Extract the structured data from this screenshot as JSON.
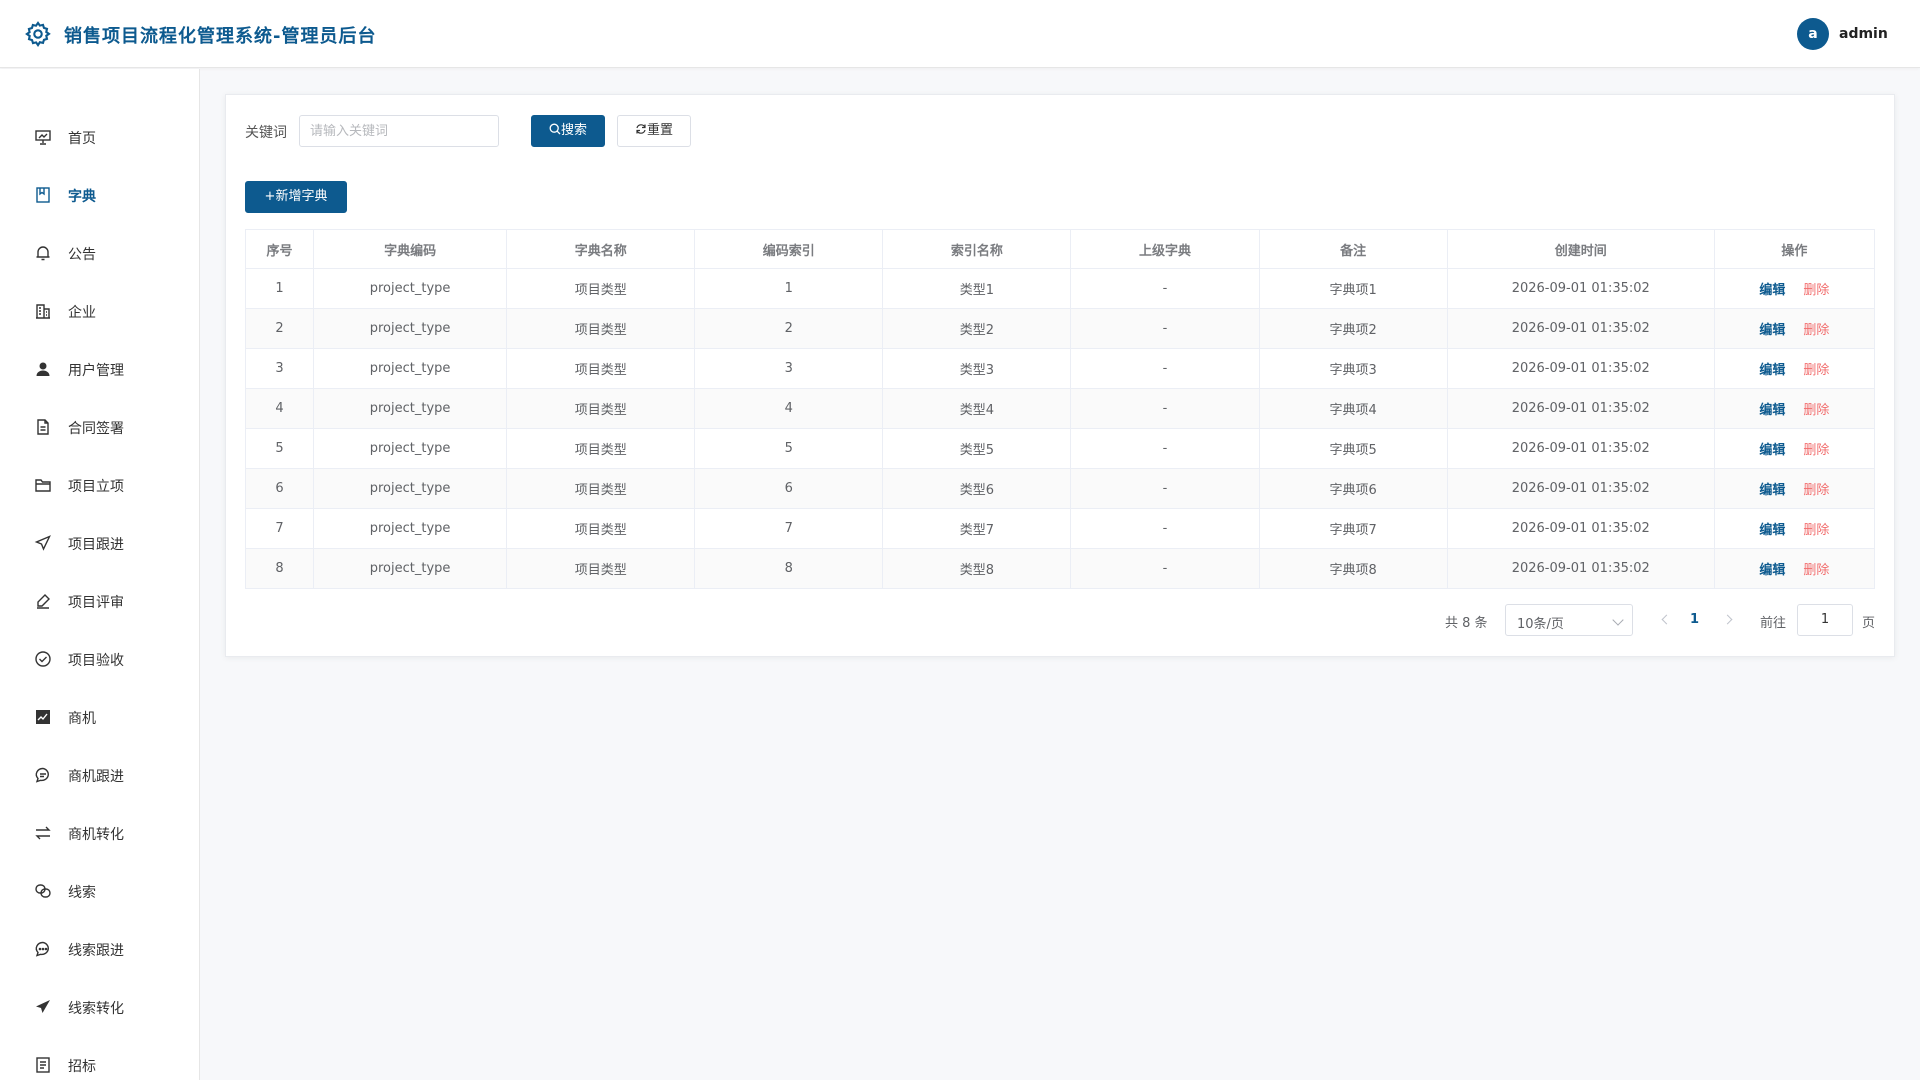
{
  "header": {
    "title": "销售项目流程化管理系统-管理员后台",
    "avatar_letter": "a",
    "username": "admin",
    "brand_color": "#0d5a8f"
  },
  "sidebar": {
    "items": [
      {
        "label": "首页",
        "icon": "chart-board-icon"
      },
      {
        "label": "字典",
        "icon": "book-icon",
        "active": true
      },
      {
        "label": "公告",
        "icon": "bell-icon"
      },
      {
        "label": "企业",
        "icon": "building-icon"
      },
      {
        "label": "用户管理",
        "icon": "user-icon"
      },
      {
        "label": "合同签署",
        "icon": "document-icon"
      },
      {
        "label": "项目立项",
        "icon": "folder-icon"
      },
      {
        "label": "项目跟进",
        "icon": "send-icon"
      },
      {
        "label": "项目评审",
        "icon": "pen-icon"
      },
      {
        "label": "项目验收",
        "icon": "check-circle-icon"
      },
      {
        "label": "商机",
        "icon": "trend-chart-icon"
      },
      {
        "label": "商机跟进",
        "icon": "chat-icon"
      },
      {
        "label": "商机转化",
        "icon": "switch-icon"
      },
      {
        "label": "线索",
        "icon": "link-icon"
      },
      {
        "label": "线索跟进",
        "icon": "chat-dots-icon"
      },
      {
        "label": "线索转化",
        "icon": "paper-plane-icon"
      },
      {
        "label": "招标",
        "icon": "list-doc-icon"
      }
    ]
  },
  "filter": {
    "keyword_label": "关键词",
    "keyword_placeholder": "请输入关键词",
    "keyword_value": "",
    "search_label": "搜索",
    "reset_label": "重置",
    "add_label": "新增字典"
  },
  "table": {
    "headers": [
      "序号",
      "字典编码",
      "字典名称",
      "编码索引",
      "索引名称",
      "上级字典",
      "备注",
      "创建时间",
      "操作"
    ],
    "rows": [
      {
        "no": "1",
        "code": "project_type",
        "name": "项目类型",
        "index": "1",
        "index_name": "类型1",
        "parent": "-",
        "remark": "字典项1",
        "created": "2026-09-01 01:35:02"
      },
      {
        "no": "2",
        "code": "project_type",
        "name": "项目类型",
        "index": "2",
        "index_name": "类型2",
        "parent": "-",
        "remark": "字典项2",
        "created": "2026-09-01 01:35:02"
      },
      {
        "no": "3",
        "code": "project_type",
        "name": "项目类型",
        "index": "3",
        "index_name": "类型3",
        "parent": "-",
        "remark": "字典项3",
        "created": "2026-09-01 01:35:02"
      },
      {
        "no": "4",
        "code": "project_type",
        "name": "项目类型",
        "index": "4",
        "index_name": "类型4",
        "parent": "-",
        "remark": "字典项4",
        "created": "2026-09-01 01:35:02"
      },
      {
        "no": "5",
        "code": "project_type",
        "name": "项目类型",
        "index": "5",
        "index_name": "类型5",
        "parent": "-",
        "remark": "字典项5",
        "created": "2026-09-01 01:35:02"
      },
      {
        "no": "6",
        "code": "project_type",
        "name": "项目类型",
        "index": "6",
        "index_name": "类型6",
        "parent": "-",
        "remark": "字典项6",
        "created": "2026-09-01 01:35:02"
      },
      {
        "no": "7",
        "code": "project_type",
        "name": "项目类型",
        "index": "7",
        "index_name": "类型7",
        "parent": "-",
        "remark": "字典项7",
        "created": "2026-09-01 01:35:02"
      },
      {
        "no": "8",
        "code": "project_type",
        "name": "项目类型",
        "index": "8",
        "index_name": "类型8",
        "parent": "-",
        "remark": "字典项8",
        "created": "2026-09-01 01:35:02"
      }
    ],
    "edit_label": "编辑",
    "delete_label": "删除"
  },
  "pagination": {
    "total_text": "共 8 条",
    "page_size": "10条/页",
    "current_page": "1",
    "goto_label": "前往",
    "goto_value": "1",
    "page_suffix": "页"
  }
}
